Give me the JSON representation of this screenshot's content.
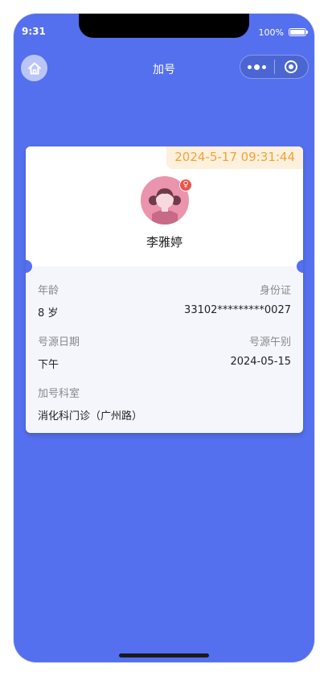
{
  "status_bar": {
    "time": "9:31",
    "battery": "100%"
  },
  "nav": {
    "title": "加号"
  },
  "card": {
    "timestamp": "2024-5-17 09:31:44",
    "patient_name": "李雅婷",
    "gender_symbol": "♀",
    "fields": {
      "age_label": "年龄",
      "age_value": "8 岁",
      "id_label": "身份证",
      "id_value": "33102*********0027",
      "date_label": "号源日期",
      "date_value": "下午",
      "period_label": "号源午别",
      "period_value": "2024-05-15",
      "dept_label": "加号科室",
      "dept_value": "消化科门诊（广州路）"
    }
  },
  "colors": {
    "background": "#5470ef",
    "timestamp_text": "#f4a233",
    "timestamp_bg": "#fdf0dd",
    "avatar": "#eb94ad",
    "gender_badge": "#f0524a"
  }
}
